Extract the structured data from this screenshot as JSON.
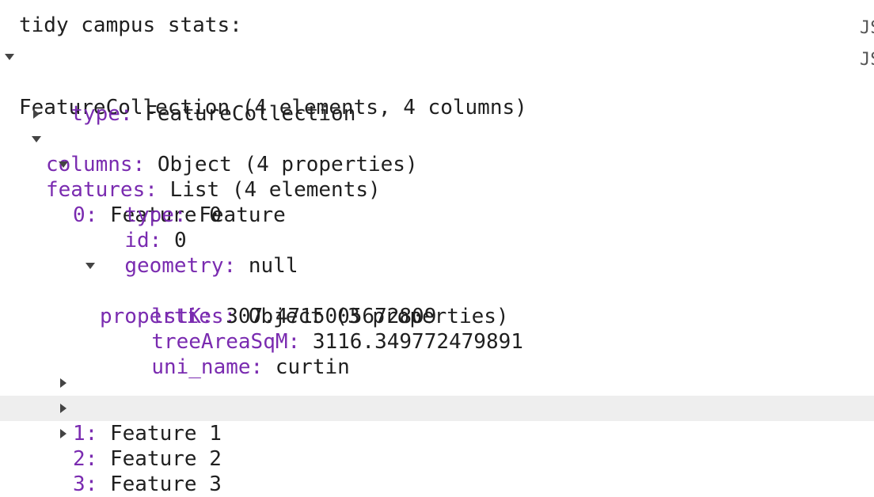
{
  "title": "tidy campus stats:",
  "side_labels": [
    "JS",
    "JS"
  ],
  "root": {
    "label": "FeatureCollection (4 elements, 4 columns)"
  },
  "type_row": {
    "key": "type:",
    "value": "FeatureCollection"
  },
  "columns_row": {
    "key": "columns:",
    "value": "Object (4 properties)"
  },
  "features_row": {
    "key": "features:",
    "value": "List (4 elements)"
  },
  "feature0": {
    "key": "0:",
    "value": "Feature 0",
    "type": {
      "key": "type:",
      "value": "Feature"
    },
    "id": {
      "key": "id:",
      "value": "0"
    },
    "geometry": {
      "key": "geometry:",
      "value": "null"
    },
    "properties": {
      "key": "properties:",
      "value": "Object (3 properties)"
    },
    "props": [
      {
        "key": "lstK:",
        "value": "307.4715005672809"
      },
      {
        "key": "treeAreaSqM:",
        "value": "3116.349772479891"
      },
      {
        "key": "uni_name:",
        "value": "curtin"
      }
    ]
  },
  "other_features": [
    {
      "key": "1:",
      "value": "Feature 1"
    },
    {
      "key": "2:",
      "value": "Feature 2"
    },
    {
      "key": "3:",
      "value": "Feature 3"
    }
  ]
}
